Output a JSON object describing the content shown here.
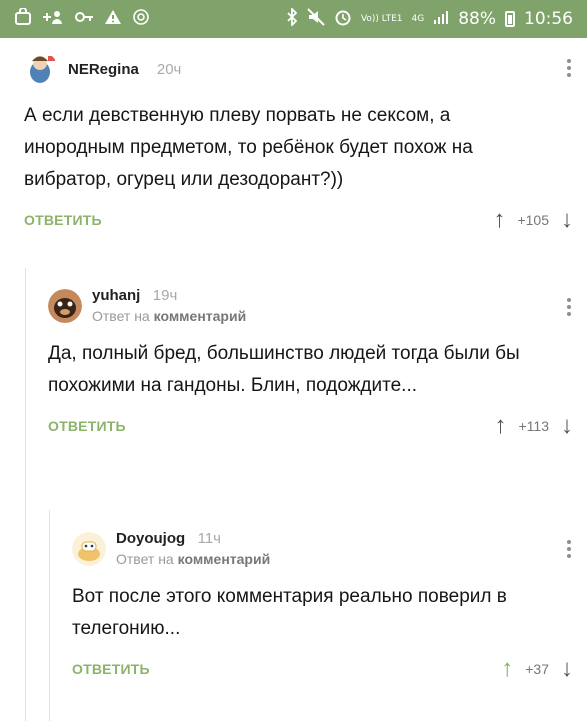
{
  "status_bar": {
    "network": "Vo)) LTE1",
    "signal": "4G",
    "battery": "88%",
    "time": "10:56"
  },
  "comments": [
    {
      "author": "NERegina",
      "time": "20ч",
      "reply_prefix": "",
      "reply_target": "",
      "text": "А если девственную плеву порвать не сексом, а инородным предметом, то ребёнок будет похож на вибратор, огурец или дезодорант?))",
      "reply_label": "ОТВЕТИТЬ",
      "votes": "+105"
    },
    {
      "author": "yuhanj",
      "time": "19ч",
      "reply_prefix": "Ответ на",
      "reply_target": "комментарий",
      "text": "Да, полный бред, большинство людей тогда были бы похожими на гандоны. Блин, подождите...",
      "reply_label": "ОТВЕТИТЬ",
      "votes": "+113"
    },
    {
      "author": "Doyoujog",
      "time": "11ч",
      "reply_prefix": "Ответ на",
      "reply_target": "комментарий",
      "text": "Вот после этого комментария реально поверил в телегонию...",
      "reply_label": "ОТВЕТИТЬ",
      "votes": "+37"
    }
  ],
  "icons": {
    "up_arrow": "↑",
    "down_arrow": "↓"
  },
  "colors": {
    "status_bar": "#7fa36a",
    "reply_button": "#8cb36b",
    "upvote_active": "#7fb454"
  }
}
